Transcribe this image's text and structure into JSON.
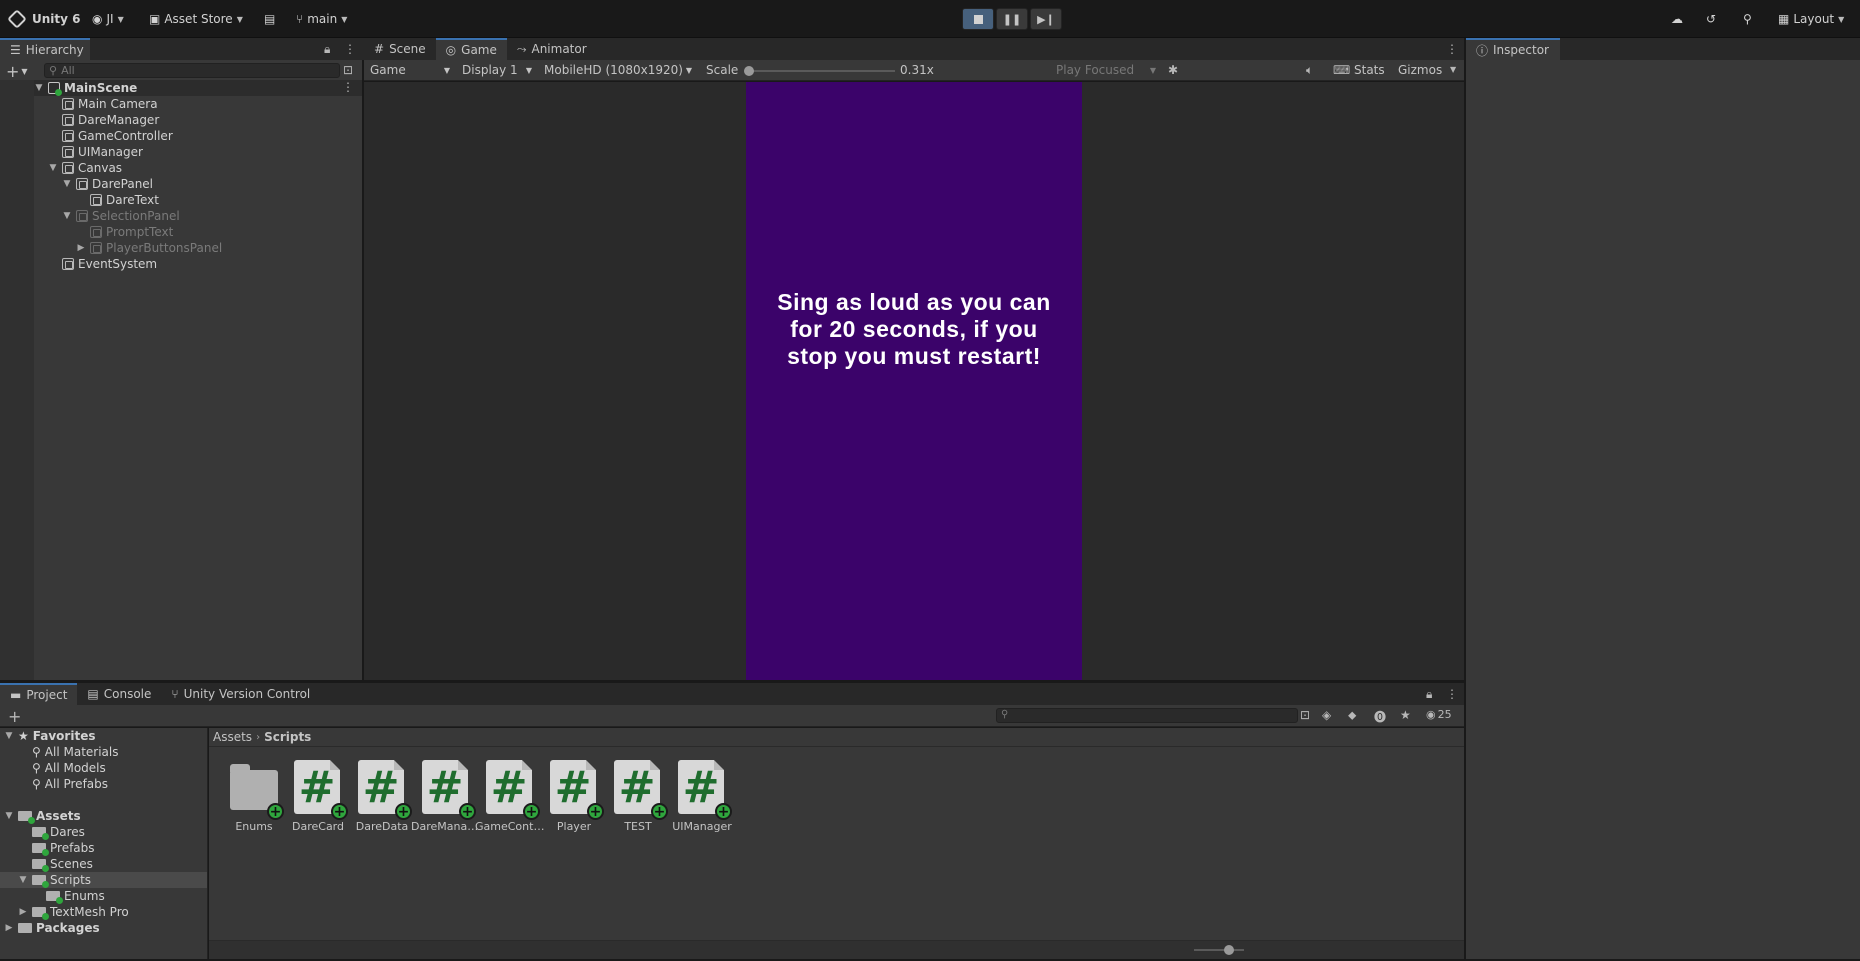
{
  "topbar": {
    "app_name": "Unity 6",
    "account": "JI",
    "asset_store": "Asset Store",
    "branch": "main",
    "layout": "Layout"
  },
  "hierarchy": {
    "tab_label": "Hierarchy",
    "search_placeholder": "All",
    "scene": "MainScene",
    "items": [
      {
        "label": "Main Camera",
        "depth": 1,
        "dim": false
      },
      {
        "label": "DareManager",
        "depth": 1,
        "dim": false
      },
      {
        "label": "GameController",
        "depth": 1,
        "dim": false
      },
      {
        "label": "UIManager",
        "depth": 1,
        "dim": false
      },
      {
        "label": "Canvas",
        "depth": 1,
        "dim": false
      },
      {
        "label": "DarePanel",
        "depth": 2,
        "dim": false
      },
      {
        "label": "DareText",
        "depth": 3,
        "dim": false
      },
      {
        "label": "SelectionPanel",
        "depth": 2,
        "dim": true
      },
      {
        "label": "PromptText",
        "depth": 3,
        "dim": true
      },
      {
        "label": "PlayerButtonsPanel",
        "depth": 3,
        "dim": true
      },
      {
        "label": "EventSystem",
        "depth": 1,
        "dim": false
      }
    ]
  },
  "center_tabs": [
    "Scene",
    "Game",
    "Animator"
  ],
  "game_toolbar": {
    "view": "Game",
    "display": "Display 1",
    "resolution": "MobileHD (1080x1920)",
    "scale_label": "Scale",
    "scale_value": "0.31x",
    "play_mode": "Play Focused",
    "stats": "Stats",
    "gizmos": "Gizmos"
  },
  "game_view": {
    "dare_text": "Sing as loud as you can for 20 seconds, if you stop you must restart!",
    "bg_color": "#3b036a"
  },
  "inspector": {
    "tab_label": "Inspector"
  },
  "bottom_tabs": [
    "Project",
    "Console",
    "Unity Version Control"
  ],
  "project": {
    "hidden_count": "25",
    "breadcrumb": [
      "Assets",
      "Scripts"
    ],
    "favorites": {
      "label": "Favorites",
      "items": [
        "All Materials",
        "All Models",
        "All Prefabs"
      ]
    },
    "assets_tree": {
      "label": "Assets",
      "items": [
        "Dares",
        "Prefabs",
        "Scenes",
        "Scripts",
        "Enums",
        "TextMesh Pro"
      ]
    },
    "packages": "Packages",
    "files": [
      {
        "name": "Enums",
        "type": "folder"
      },
      {
        "name": "DareCard",
        "type": "script"
      },
      {
        "name": "DareData",
        "type": "script"
      },
      {
        "name": "DareManager",
        "type": "script"
      },
      {
        "name": "GameContr...",
        "type": "script"
      },
      {
        "name": "Player",
        "type": "script"
      },
      {
        "name": "TEST",
        "type": "script"
      },
      {
        "name": "UIManager",
        "type": "script"
      }
    ]
  }
}
